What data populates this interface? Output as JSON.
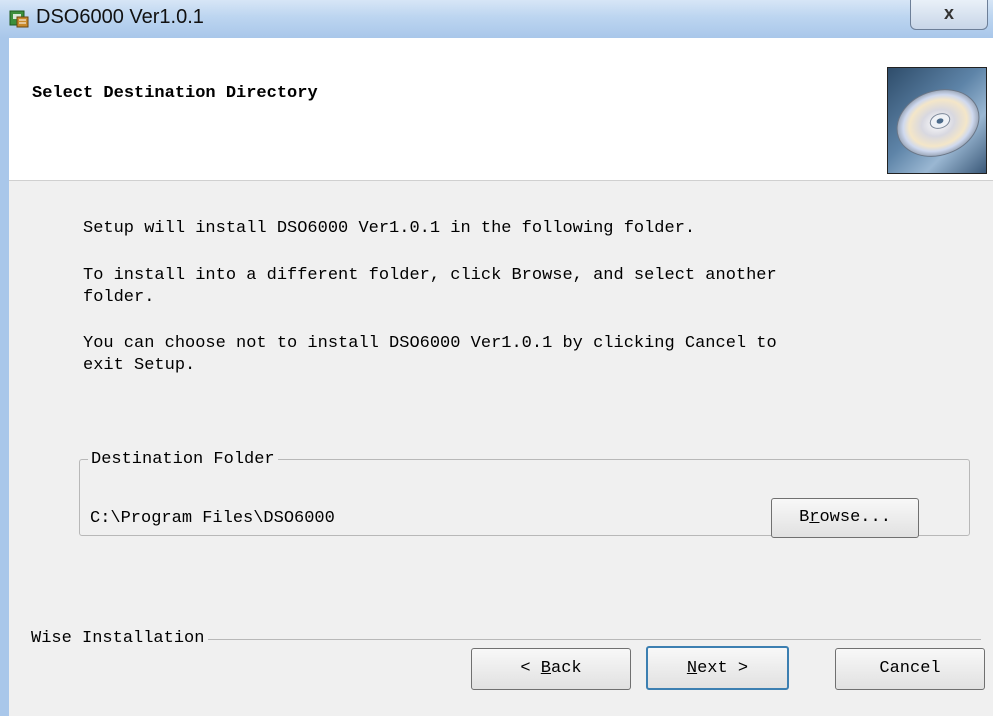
{
  "window": {
    "title": "DSO6000 Ver1.0.1",
    "close_label": "x"
  },
  "header": {
    "title": "Select Destination Directory"
  },
  "body": {
    "line1": "Setup will install DSO6000 Ver1.0.1 in the following folder.",
    "line2a": "To install into a different folder, click Browse, and select another",
    "line2b": "folder.",
    "line3a": "You can choose not to install DSO6000 Ver1.0.1 by clicking Cancel to",
    "line3b": "exit Setup."
  },
  "destination": {
    "legend": "Destination Folder",
    "path": "C:\\Program Files\\DSO6000",
    "browse_pre": "B",
    "browse_accel": "r",
    "browse_post": "owse..."
  },
  "footer": {
    "group_label": "Wise Installation",
    "back_pre": "< ",
    "back_accel": "B",
    "back_post": "ack",
    "next_accel": "N",
    "next_post": "ext >",
    "cancel_label": "Cancel"
  },
  "icons": {
    "app": "installer-icon",
    "header": "cd-disc-icon"
  }
}
